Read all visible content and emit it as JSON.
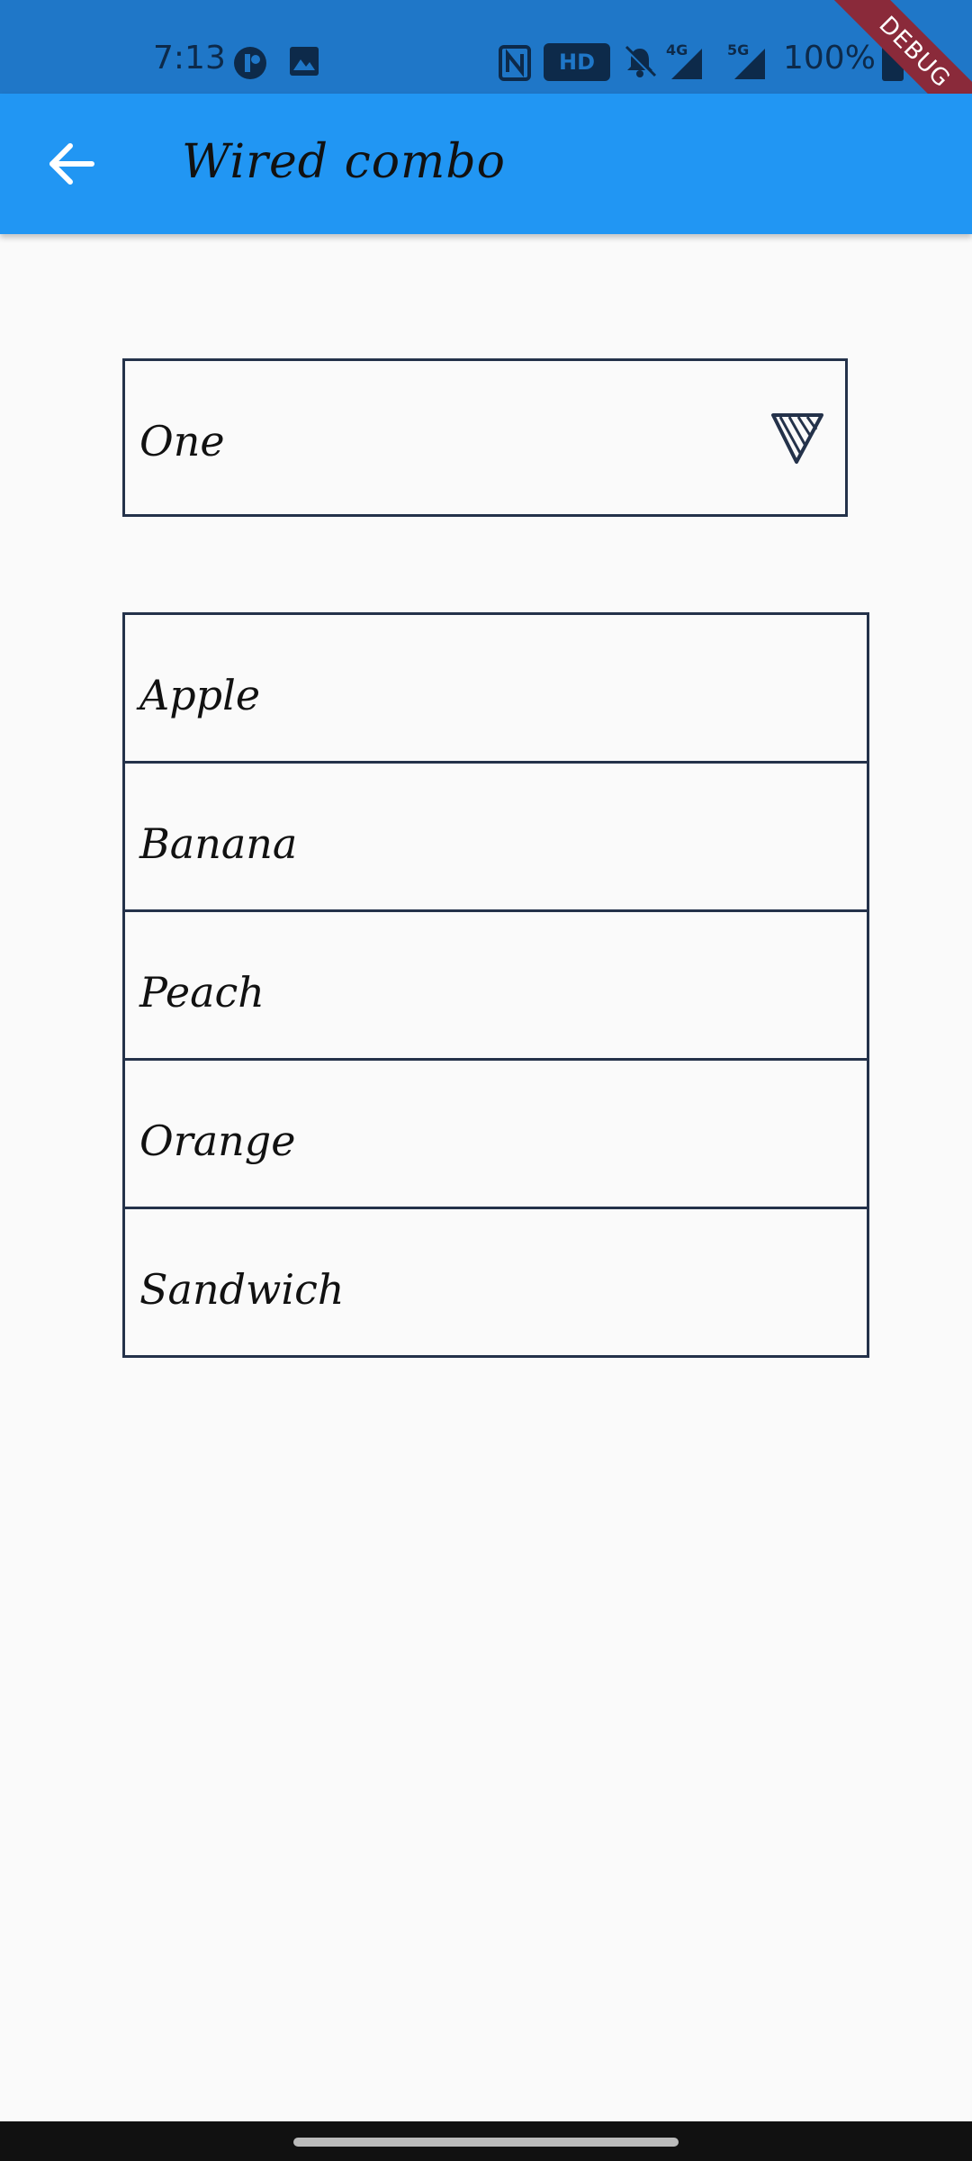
{
  "status_bar": {
    "time": "7:13",
    "battery": "100%",
    "hd_label": "HD",
    "network_4g": "4G",
    "network_5g": "5G"
  },
  "debug_banner": "DEBUG",
  "app_bar": {
    "title": "Wired combo",
    "back_icon": "arrow-back-icon"
  },
  "combo": {
    "selected_value": "One",
    "arrow_icon": "triangle-down-icon"
  },
  "list": {
    "items": [
      {
        "label": "Apple"
      },
      {
        "label": "Banana"
      },
      {
        "label": "Peach"
      },
      {
        "label": "Orange"
      },
      {
        "label": "Sandwich"
      }
    ]
  },
  "colors": {
    "status_bar": "#1f77c8",
    "app_bar": "#2196f3",
    "background": "#fafafa",
    "border": "#24324a",
    "debug_ribbon": "#8a2a3a"
  }
}
